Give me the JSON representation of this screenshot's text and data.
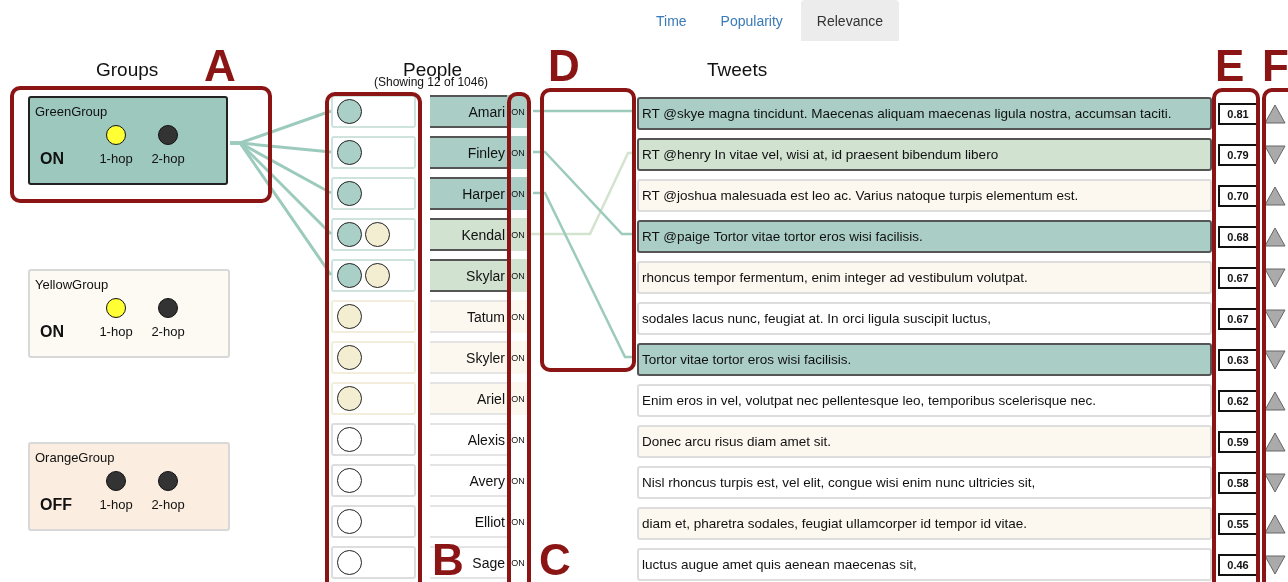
{
  "tabs": [
    {
      "label": "Time",
      "selected": false
    },
    {
      "label": "Popularity",
      "selected": false
    },
    {
      "label": "Relevance",
      "selected": true
    }
  ],
  "groups": {
    "title": "Groups",
    "items": [
      {
        "name": "GreenGroup",
        "state": "ON",
        "selected": true,
        "color": "#9dc8bd",
        "hops": [
          {
            "label": "1-hop",
            "color": "#ffff33"
          },
          {
            "label": "2-hop",
            "color": "#333333"
          }
        ]
      },
      {
        "name": "YellowGroup",
        "state": "ON",
        "selected": false,
        "color": "#fdfaf3",
        "hops": [
          {
            "label": "1-hop",
            "color": "#ffff33"
          },
          {
            "label": "2-hop",
            "color": "#333333"
          }
        ]
      },
      {
        "name": "OrangeGroup",
        "state": "OFF",
        "selected": false,
        "color": "#fbeee0",
        "hops": [
          {
            "label": "1-hop",
            "color": "#333333"
          },
          {
            "label": "2-hop",
            "color": "#333333"
          }
        ]
      }
    ]
  },
  "people": {
    "title": "People",
    "subtitle": "(Showing 12 of 1046)",
    "rows": [
      {
        "name": "Amari",
        "toggle": "ON",
        "kind": "green",
        "circles": [
          {
            "color": "#a9cfc6"
          }
        ]
      },
      {
        "name": "Finley",
        "toggle": "ON",
        "kind": "green",
        "circles": [
          {
            "color": "#a9cfc6"
          }
        ]
      },
      {
        "name": "Harper",
        "toggle": "ON",
        "kind": "green",
        "circles": [
          {
            "color": "#a9cfc6"
          }
        ]
      },
      {
        "name": "Kendal",
        "toggle": "ON",
        "kind": "light",
        "circles": [
          {
            "color": "#a9cfc6"
          },
          {
            "color": "#f3eed2"
          }
        ]
      },
      {
        "name": "Skylar",
        "toggle": "ON",
        "kind": "light",
        "circles": [
          {
            "color": "#a9cfc6"
          },
          {
            "color": "#f3eed2"
          }
        ]
      },
      {
        "name": "Tatum",
        "toggle": "ON",
        "kind": "cream",
        "circles": [
          {
            "color": "#f3eed2"
          }
        ]
      },
      {
        "name": "Skyler",
        "toggle": "ON",
        "kind": "cream",
        "circles": [
          {
            "color": "#f3eed2"
          }
        ]
      },
      {
        "name": "Ariel",
        "toggle": "ON",
        "kind": "cream",
        "circles": [
          {
            "color": "#f3eed2"
          }
        ]
      },
      {
        "name": "Alexis",
        "toggle": "ON",
        "kind": "plain",
        "circles": [
          {
            "color": "#ffffff"
          }
        ]
      },
      {
        "name": "Avery",
        "toggle": "ON",
        "kind": "plain",
        "circles": [
          {
            "color": "#ffffff"
          }
        ]
      },
      {
        "name": "Elliot",
        "toggle": "ON",
        "kind": "plain",
        "circles": [
          {
            "color": "#ffffff"
          }
        ]
      },
      {
        "name": "Sage",
        "toggle": "ON",
        "kind": "plain",
        "circles": [
          {
            "color": "#ffffff"
          }
        ]
      }
    ]
  },
  "tweets": {
    "title": "Tweets",
    "rows": [
      {
        "text": "RT @skye magna tincidunt. Maecenas aliquam maecenas ligula nostra, accumsan taciti.",
        "score": "0.81",
        "kind": "green",
        "rising": true
      },
      {
        "text": "RT @henry In vitae vel, wisi at, id praesent bibendum libero",
        "score": "0.79",
        "kind": "light",
        "rising": false
      },
      {
        "text": "RT @joshua malesuada est leo ac. Varius natoque turpis elementum est.",
        "score": "0.70",
        "kind": "cream",
        "rising": true
      },
      {
        "text": "RT @paige Tortor vitae tortor eros wisi facilisis.",
        "score": "0.68",
        "kind": "green",
        "rising": true
      },
      {
        "text": "rhoncus tempor fermentum, enim integer ad vestibulum volutpat.",
        "score": "0.67",
        "kind": "cream",
        "rising": false
      },
      {
        "text": "sodales lacus nunc, feugiat at. In orci ligula suscipit luctus,",
        "score": "0.67",
        "kind": "plain",
        "rising": false
      },
      {
        "text": "Tortor vitae tortor eros wisi facilisis.",
        "score": "0.63",
        "kind": "green",
        "rising": false
      },
      {
        "text": "Enim eros in vel, volutpat nec pellentesque leo, temporibus scelerisque nec.",
        "score": "0.62",
        "kind": "plain",
        "rising": true
      },
      {
        "text": "Donec arcu risus diam amet sit.",
        "score": "0.59",
        "kind": "cream",
        "rising": true
      },
      {
        "text": "Nisl rhoncus turpis est, vel elit, congue wisi enim nunc ultricies sit,",
        "score": "0.58",
        "kind": "plain",
        "rising": false
      },
      {
        "text": "diam et, pharetra sodales, feugiat ullamcorper id tempor id vitae.",
        "score": "0.55",
        "kind": "cream",
        "rising": true
      },
      {
        "text": "luctus augue amet quis aenean maecenas sit,",
        "score": "0.46",
        "kind": "plain",
        "rising": false
      }
    ]
  },
  "annotations": [
    {
      "label": "A"
    },
    {
      "label": "D"
    },
    {
      "label": "E"
    },
    {
      "label": "F"
    },
    {
      "label": "B"
    },
    {
      "label": "C"
    }
  ]
}
